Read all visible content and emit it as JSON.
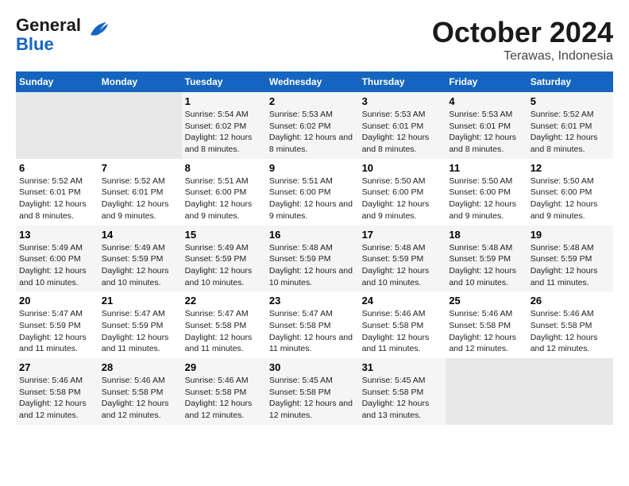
{
  "header": {
    "logo_line1": "General",
    "logo_line2": "Blue",
    "month": "October 2024",
    "location": "Terawas, Indonesia"
  },
  "weekdays": [
    "Sunday",
    "Monday",
    "Tuesday",
    "Wednesday",
    "Thursday",
    "Friday",
    "Saturday"
  ],
  "weeks": [
    [
      {
        "day": "",
        "sunrise": "",
        "sunset": "",
        "daylight": ""
      },
      {
        "day": "",
        "sunrise": "",
        "sunset": "",
        "daylight": ""
      },
      {
        "day": "1",
        "sunrise": "Sunrise: 5:54 AM",
        "sunset": "Sunset: 6:02 PM",
        "daylight": "Daylight: 12 hours and 8 minutes."
      },
      {
        "day": "2",
        "sunrise": "Sunrise: 5:53 AM",
        "sunset": "Sunset: 6:02 PM",
        "daylight": "Daylight: 12 hours and 8 minutes."
      },
      {
        "day": "3",
        "sunrise": "Sunrise: 5:53 AM",
        "sunset": "Sunset: 6:01 PM",
        "daylight": "Daylight: 12 hours and 8 minutes."
      },
      {
        "day": "4",
        "sunrise": "Sunrise: 5:53 AM",
        "sunset": "Sunset: 6:01 PM",
        "daylight": "Daylight: 12 hours and 8 minutes."
      },
      {
        "day": "5",
        "sunrise": "Sunrise: 5:52 AM",
        "sunset": "Sunset: 6:01 PM",
        "daylight": "Daylight: 12 hours and 8 minutes."
      }
    ],
    [
      {
        "day": "6",
        "sunrise": "Sunrise: 5:52 AM",
        "sunset": "Sunset: 6:01 PM",
        "daylight": "Daylight: 12 hours and 8 minutes."
      },
      {
        "day": "7",
        "sunrise": "Sunrise: 5:52 AM",
        "sunset": "Sunset: 6:01 PM",
        "daylight": "Daylight: 12 hours and 9 minutes."
      },
      {
        "day": "8",
        "sunrise": "Sunrise: 5:51 AM",
        "sunset": "Sunset: 6:00 PM",
        "daylight": "Daylight: 12 hours and 9 minutes."
      },
      {
        "day": "9",
        "sunrise": "Sunrise: 5:51 AM",
        "sunset": "Sunset: 6:00 PM",
        "daylight": "Daylight: 12 hours and 9 minutes."
      },
      {
        "day": "10",
        "sunrise": "Sunrise: 5:50 AM",
        "sunset": "Sunset: 6:00 PM",
        "daylight": "Daylight: 12 hours and 9 minutes."
      },
      {
        "day": "11",
        "sunrise": "Sunrise: 5:50 AM",
        "sunset": "Sunset: 6:00 PM",
        "daylight": "Daylight: 12 hours and 9 minutes."
      },
      {
        "day": "12",
        "sunrise": "Sunrise: 5:50 AM",
        "sunset": "Sunset: 6:00 PM",
        "daylight": "Daylight: 12 hours and 9 minutes."
      }
    ],
    [
      {
        "day": "13",
        "sunrise": "Sunrise: 5:49 AM",
        "sunset": "Sunset: 6:00 PM",
        "daylight": "Daylight: 12 hours and 10 minutes."
      },
      {
        "day": "14",
        "sunrise": "Sunrise: 5:49 AM",
        "sunset": "Sunset: 5:59 PM",
        "daylight": "Daylight: 12 hours and 10 minutes."
      },
      {
        "day": "15",
        "sunrise": "Sunrise: 5:49 AM",
        "sunset": "Sunset: 5:59 PM",
        "daylight": "Daylight: 12 hours and 10 minutes."
      },
      {
        "day": "16",
        "sunrise": "Sunrise: 5:48 AM",
        "sunset": "Sunset: 5:59 PM",
        "daylight": "Daylight: 12 hours and 10 minutes."
      },
      {
        "day": "17",
        "sunrise": "Sunrise: 5:48 AM",
        "sunset": "Sunset: 5:59 PM",
        "daylight": "Daylight: 12 hours and 10 minutes."
      },
      {
        "day": "18",
        "sunrise": "Sunrise: 5:48 AM",
        "sunset": "Sunset: 5:59 PM",
        "daylight": "Daylight: 12 hours and 10 minutes."
      },
      {
        "day": "19",
        "sunrise": "Sunrise: 5:48 AM",
        "sunset": "Sunset: 5:59 PM",
        "daylight": "Daylight: 12 hours and 11 minutes."
      }
    ],
    [
      {
        "day": "20",
        "sunrise": "Sunrise: 5:47 AM",
        "sunset": "Sunset: 5:59 PM",
        "daylight": "Daylight: 12 hours and 11 minutes."
      },
      {
        "day": "21",
        "sunrise": "Sunrise: 5:47 AM",
        "sunset": "Sunset: 5:59 PM",
        "daylight": "Daylight: 12 hours and 11 minutes."
      },
      {
        "day": "22",
        "sunrise": "Sunrise: 5:47 AM",
        "sunset": "Sunset: 5:58 PM",
        "daylight": "Daylight: 12 hours and 11 minutes."
      },
      {
        "day": "23",
        "sunrise": "Sunrise: 5:47 AM",
        "sunset": "Sunset: 5:58 PM",
        "daylight": "Daylight: 12 hours and 11 minutes."
      },
      {
        "day": "24",
        "sunrise": "Sunrise: 5:46 AM",
        "sunset": "Sunset: 5:58 PM",
        "daylight": "Daylight: 12 hours and 11 minutes."
      },
      {
        "day": "25",
        "sunrise": "Sunrise: 5:46 AM",
        "sunset": "Sunset: 5:58 PM",
        "daylight": "Daylight: 12 hours and 12 minutes."
      },
      {
        "day": "26",
        "sunrise": "Sunrise: 5:46 AM",
        "sunset": "Sunset: 5:58 PM",
        "daylight": "Daylight: 12 hours and 12 minutes."
      }
    ],
    [
      {
        "day": "27",
        "sunrise": "Sunrise: 5:46 AM",
        "sunset": "Sunset: 5:58 PM",
        "daylight": "Daylight: 12 hours and 12 minutes."
      },
      {
        "day": "28",
        "sunrise": "Sunrise: 5:46 AM",
        "sunset": "Sunset: 5:58 PM",
        "daylight": "Daylight: 12 hours and 12 minutes."
      },
      {
        "day": "29",
        "sunrise": "Sunrise: 5:46 AM",
        "sunset": "Sunset: 5:58 PM",
        "daylight": "Daylight: 12 hours and 12 minutes."
      },
      {
        "day": "30",
        "sunrise": "Sunrise: 5:45 AM",
        "sunset": "Sunset: 5:58 PM",
        "daylight": "Daylight: 12 hours and 12 minutes."
      },
      {
        "day": "31",
        "sunrise": "Sunrise: 5:45 AM",
        "sunset": "Sunset: 5:58 PM",
        "daylight": "Daylight: 12 hours and 13 minutes."
      },
      {
        "day": "",
        "sunrise": "",
        "sunset": "",
        "daylight": ""
      },
      {
        "day": "",
        "sunrise": "",
        "sunset": "",
        "daylight": ""
      }
    ]
  ]
}
